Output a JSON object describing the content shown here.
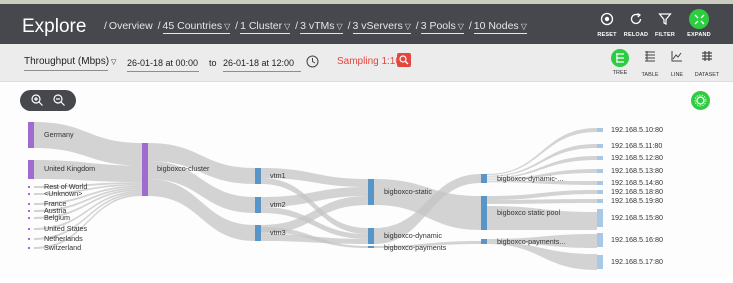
{
  "header": {
    "title": "Explore",
    "breadcrumb": [
      {
        "label": "Overview",
        "dropdown": false
      },
      {
        "label": "45 Countries",
        "dropdown": true
      },
      {
        "label": "1 Cluster",
        "dropdown": true
      },
      {
        "label": "3 vTMs",
        "dropdown": true
      },
      {
        "label": "3 vServers",
        "dropdown": true
      },
      {
        "label": "3 Pools",
        "dropdown": true
      },
      {
        "label": "10 Nodes",
        "dropdown": true
      }
    ],
    "actions": [
      {
        "label": "RESET",
        "icon": "reset-icon"
      },
      {
        "label": "RELOAD",
        "icon": "reload-icon"
      },
      {
        "label": "FILTER",
        "icon": "filter-icon"
      },
      {
        "label": "EXPAND",
        "icon": "expand-icon"
      }
    ]
  },
  "toolbar": {
    "metric": "Throughput (Mbps)",
    "from": "26-01-18 at 00:00",
    "to_label": "to",
    "to": "26-01-18 at 12:00",
    "sampling": "Sampling 1:10*",
    "views": [
      {
        "label": "TREE",
        "active": true
      },
      {
        "label": "TABLE",
        "active": false
      },
      {
        "label": "LINE",
        "active": false
      },
      {
        "label": "DATASET",
        "active": false
      }
    ]
  },
  "sankey": {
    "countries": [
      "Germany",
      "United Kingdom",
      "Rest of World",
      "<Unknown>",
      "France",
      "Austria",
      "Belgium",
      "United States",
      "Netherlands",
      "Switzerland"
    ],
    "cluster": "bigboxco-cluster",
    "vtms": [
      "vtm1",
      "vtm2",
      "vtm3"
    ],
    "vservers": [
      "bigboxco-static",
      "bigboxco-dynamic",
      "bigboxco-payments"
    ],
    "pools": [
      "bigboxco-dynamic-...",
      "bigboxco static pool",
      "bigboxco-payments..."
    ],
    "nodes": [
      "192.168.5.10:80",
      "192.168.5.11:80",
      "192.168.5.12:80",
      "192.168.5.13:80",
      "192.168.5.14:80",
      "192.168.5.18:80",
      "192.168.5.19:80",
      "192.168.5.15:80",
      "192.168.5.16:80",
      "192.168.5.17:80"
    ]
  },
  "colors": {
    "header_bg": "#46484d",
    "accent_green": "#2ecc40",
    "country_node": "#a06bd0",
    "blue_node": "#5a95c8",
    "node_light": "#a8c8e6",
    "link": "#c4c4c4",
    "sampling": "#e4463e"
  }
}
